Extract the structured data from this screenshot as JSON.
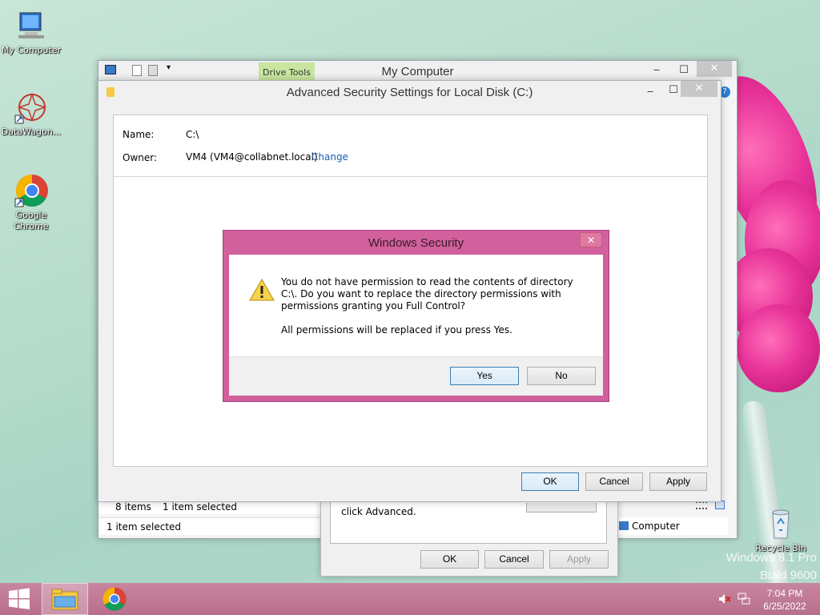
{
  "desktop": {
    "icons": [
      {
        "label": "My Computer"
      },
      {
        "label": "DataWagon..."
      },
      {
        "label": "Google Chrome"
      },
      {
        "label": "Recycle Bin"
      }
    ],
    "watermark_line1": "Windows 8.1 Pro",
    "watermark_line2": "Build 9600"
  },
  "explorer": {
    "title": "My Computer",
    "ribbon_tab": "Drive Tools",
    "status_items": "8 items",
    "status_selected": "1 item selected",
    "details_selected": "1 item selected",
    "nav_computer": "Computer"
  },
  "properties": {
    "hint": "click Advanced.",
    "ok": "OK",
    "cancel": "Cancel",
    "apply": "Apply"
  },
  "advanced": {
    "title": "Advanced Security Settings for Local Disk (C:)",
    "name_label": "Name:",
    "name_value": "C:\\",
    "owner_label": "Owner:",
    "owner_value": "VM4 (VM4@collabnet.local)",
    "change_link": "Change",
    "ok": "OK",
    "cancel": "Cancel",
    "apply": "Apply"
  },
  "dialog": {
    "title": "Windows Security",
    "message": "You do not have permission to read the contents of directory C:\\. Do you want to replace the directory permissions with permissions granting you Full Control?",
    "note": "All permissions will be replaced if you press Yes.",
    "yes": "Yes",
    "no": "No"
  },
  "taskbar": {
    "time": "7:04 PM",
    "date": "6/25/2022"
  },
  "colors": {
    "dialog_border": "#d1609c",
    "taskbar": "#b86f8c",
    "link": "#1a5fb4",
    "ribbon_tab": "#c8e6a0"
  }
}
